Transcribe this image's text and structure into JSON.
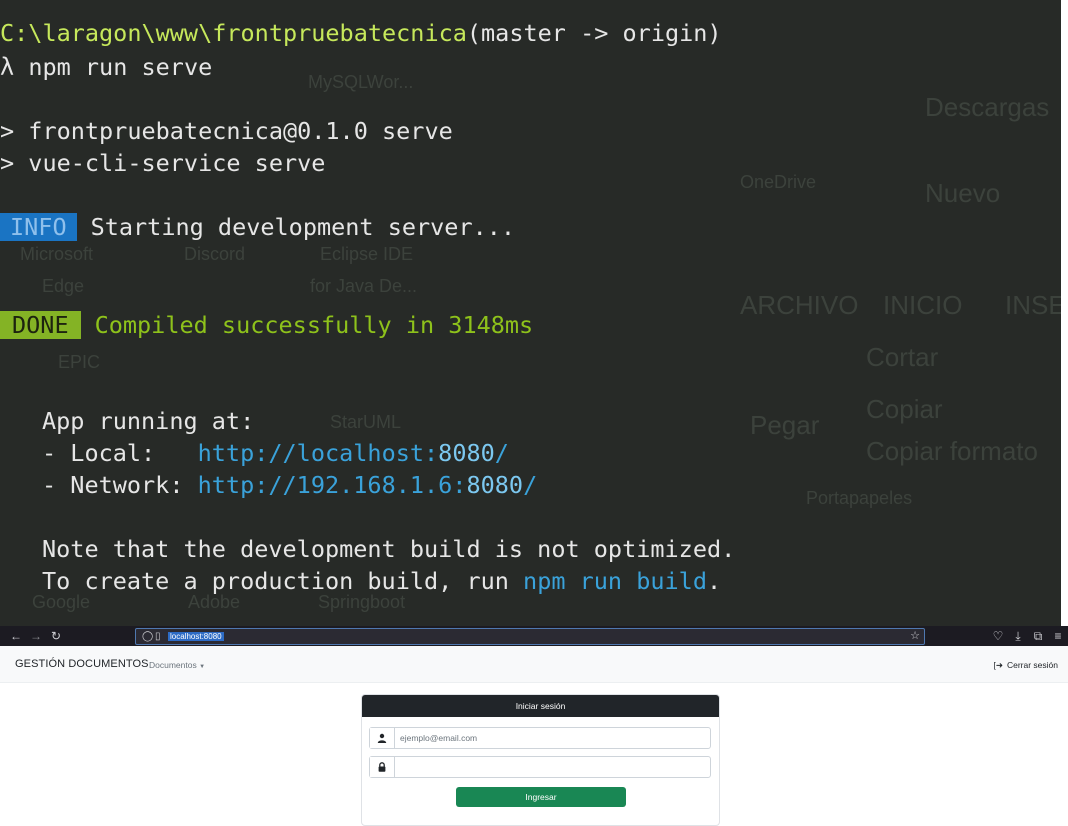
{
  "terminal": {
    "prompt_path": "C:\\laragon\\www\\frontpruebatecnica",
    "prompt_branch": "(master -> origin)",
    "prompt_symbol": "λ",
    "command": "npm run serve",
    "script_line_1": "> frontpruebatecnica@0.1.0 serve",
    "script_line_2": "> vue-cli-service serve",
    "info_badge": "INFO",
    "info_text": "Starting development server...",
    "done_badge": "DONE",
    "done_text": "Compiled successfully in 3148ms",
    "app_running": "App running at:",
    "local_label": "- Local:   ",
    "local_url_prefix": "http://localhost:",
    "local_port": "8080",
    "local_url_suffix": "/",
    "network_label": "- Network: ",
    "network_url_prefix": "http://192.168.1.6:",
    "network_port": "8080",
    "network_url_suffix": "/",
    "note_line_1": "Note that the development build is not optimized.",
    "note_line_2_prefix": "To create a production build, run ",
    "note_line_2_cmd": "npm run build",
    "note_line_2_suffix": ".",
    "background_ghosts": [
      "MySQLWor...",
      "OneDrive",
      "Nuevo",
      "Descargas",
      "ARCHIVO",
      "INICIO",
      "INSE",
      "Microsoft",
      "Edge",
      "Discord",
      "Eclipse IDE",
      "for Java De...",
      "Cortar",
      "Copiar",
      "Pegar",
      "Copiar formato",
      "Portapapeles",
      "StarUML",
      "Google",
      "Adobe",
      "Springboot",
      "EPIC"
    ]
  },
  "browser": {
    "url": "localhost:8080",
    "nav": {
      "brand": "GESTIÓN DOCUMENTOS",
      "documents_menu": "Documentos",
      "logout": "Cerrar sesión"
    },
    "login_card": {
      "title": "Iniciar sesión",
      "email_placeholder": "ejemplo@email.com",
      "password_value": "",
      "submit": "Ingresar"
    }
  },
  "colors": {
    "terminal_bg": "#272a27",
    "prompt_yellow": "#c6e85b",
    "success_green": "#8ec21b",
    "url_blue": "#3aa2da",
    "info_badge_bg": "#1a74c3",
    "done_badge_bg": "#84b325",
    "submit_green": "#198754",
    "card_header_bg": "#212529"
  },
  "icons": [
    "back-arrow-icon",
    "forward-arrow-icon",
    "reload-icon",
    "shield-icon",
    "page-icon",
    "star-icon",
    "pocket-icon",
    "download-icon",
    "extensions-icon",
    "menu-icon",
    "caret-down-icon",
    "logout-icon",
    "user-icon",
    "lock-icon"
  ]
}
